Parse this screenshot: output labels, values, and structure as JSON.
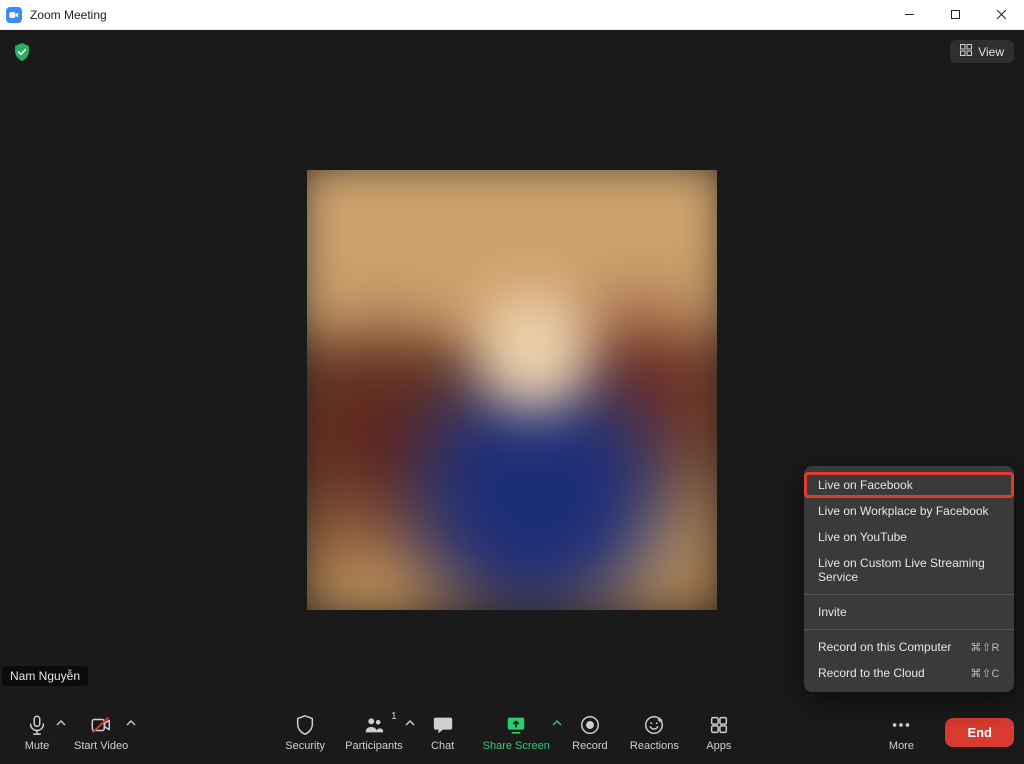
{
  "window": {
    "title": "Zoom Meeting"
  },
  "top": {
    "view_label": "View"
  },
  "participant_name": "Nam Nguyễn",
  "toolbar": {
    "mute": "Mute",
    "start_video": "Start Video",
    "security": "Security",
    "participants": "Participants",
    "participants_count": "1",
    "chat": "Chat",
    "share_screen": "Share Screen",
    "record": "Record",
    "reactions": "Reactions",
    "apps": "Apps",
    "more": "More",
    "end": "End"
  },
  "more_menu": {
    "live_facebook": "Live on Facebook",
    "live_workplace": "Live on Workplace by Facebook",
    "live_youtube": "Live on YouTube",
    "live_custom": "Live on Custom Live Streaming Service",
    "invite": "Invite",
    "record_local": "Record on this Computer",
    "record_local_shortcut": "⌘⇧R",
    "record_cloud": "Record to the Cloud",
    "record_cloud_shortcut": "⌘⇧C"
  }
}
